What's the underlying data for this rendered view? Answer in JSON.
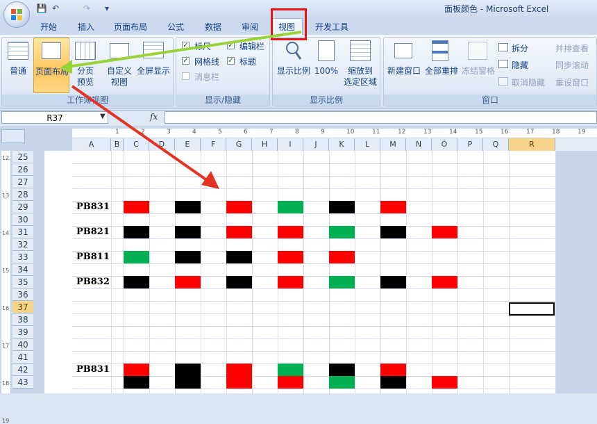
{
  "window": {
    "title": "面板颜色 - Microsoft Excel"
  },
  "tabs": [
    {
      "label": "开始"
    },
    {
      "label": "插入"
    },
    {
      "label": "页面布局"
    },
    {
      "label": "公式"
    },
    {
      "label": "数据"
    },
    {
      "label": "审阅"
    },
    {
      "label": "视图"
    },
    {
      "label": "开发工具"
    }
  ],
  "ribbon": {
    "workbook_views": {
      "group_label": "工作簿视图",
      "normal": "普通",
      "page_layout": "页面布局",
      "page_break_1": "分页",
      "page_break_2": "预览",
      "custom_1": "自定义",
      "custom_2": "视图",
      "fullscreen": "全屏显示"
    },
    "show_hide": {
      "group_label": "显示/隐藏",
      "ruler": "标尺",
      "formula_bar": "编辑栏",
      "gridlines": "网格线",
      "headings": "标题",
      "message_bar": "消息栏"
    },
    "zoom": {
      "group_label": "显示比例",
      "zoom": "显示比例",
      "hundred": "100%",
      "zoom_sel_1": "缩放到",
      "zoom_sel_2": "选定区域"
    },
    "window": {
      "group_label": "窗口",
      "new_window": "新建窗口",
      "arrange_all": "全部重排",
      "freeze": "冻结窗格",
      "split": "拆分",
      "hide": "隐藏",
      "unhide": "取消隐藏",
      "side_by_side": "并排查看",
      "sync_scroll": "同步滚动",
      "reset_pos": "重设窗口"
    }
  },
  "formula_bar": {
    "name_box": "R37",
    "fx": "fx",
    "value": ""
  },
  "columns": [
    "A",
    "B",
    "C",
    "D",
    "E",
    "F",
    "G",
    "H",
    "I",
    "J",
    "K",
    "L",
    "M",
    "N",
    "O",
    "P",
    "Q",
    "R"
  ],
  "selected_column": "R",
  "ruler_ticks": [
    "1",
    "2",
    "3",
    "4",
    "5",
    "6",
    "7",
    "8",
    "9",
    "10",
    "11",
    "12",
    "13",
    "14",
    "15",
    "16",
    "17",
    "18",
    "19"
  ],
  "rows": [
    "25",
    "26",
    "27",
    "28",
    "29",
    "30",
    "31",
    "32",
    "33",
    "34",
    "35",
    "36",
    "37",
    "38",
    "39",
    "40",
    "41",
    "42",
    "43"
  ],
  "selected_row": "37",
  "vertical_ruler": [
    "12",
    "13",
    "14",
    "15",
    "16",
    "17",
    "18",
    "19"
  ],
  "colors": {
    "red": "#ff0000",
    "black": "#000000",
    "green": "#00b050"
  },
  "sheet": {
    "labels": [
      {
        "row": "29",
        "text": "PB831"
      },
      {
        "row": "31",
        "text": "PB821"
      },
      {
        "row": "33",
        "text": "PB811"
      },
      {
        "row": "35",
        "text": "PB832"
      },
      {
        "row": "42",
        "text": "PB831"
      }
    ],
    "fills": [
      {
        "row": "29",
        "col": "C",
        "color": "red"
      },
      {
        "row": "29",
        "col": "E",
        "color": "black"
      },
      {
        "row": "29",
        "col": "G",
        "color": "red"
      },
      {
        "row": "29",
        "col": "I",
        "color": "green"
      },
      {
        "row": "29",
        "col": "K",
        "color": "black"
      },
      {
        "row": "29",
        "col": "M",
        "color": "red"
      },
      {
        "row": "31",
        "col": "C",
        "color": "black"
      },
      {
        "row": "31",
        "col": "E",
        "color": "black"
      },
      {
        "row": "31",
        "col": "G",
        "color": "red"
      },
      {
        "row": "31",
        "col": "I",
        "color": "red"
      },
      {
        "row": "31",
        "col": "K",
        "color": "green"
      },
      {
        "row": "31",
        "col": "M",
        "color": "black"
      },
      {
        "row": "31",
        "col": "O",
        "color": "red"
      },
      {
        "row": "33",
        "col": "C",
        "color": "green"
      },
      {
        "row": "33",
        "col": "E",
        "color": "black"
      },
      {
        "row": "33",
        "col": "G",
        "color": "black"
      },
      {
        "row": "33",
        "col": "I",
        "color": "red"
      },
      {
        "row": "33",
        "col": "K",
        "color": "red"
      },
      {
        "row": "35",
        "col": "C",
        "color": "black"
      },
      {
        "row": "35",
        "col": "E",
        "color": "red"
      },
      {
        "row": "35",
        "col": "G",
        "color": "black"
      },
      {
        "row": "35",
        "col": "I",
        "color": "red"
      },
      {
        "row": "35",
        "col": "K",
        "color": "green"
      },
      {
        "row": "35",
        "col": "M",
        "color": "black"
      },
      {
        "row": "35",
        "col": "O",
        "color": "red"
      },
      {
        "row": "42",
        "col": "C",
        "color": "red"
      },
      {
        "row": "42",
        "col": "E",
        "color": "black"
      },
      {
        "row": "42",
        "col": "G",
        "color": "red"
      },
      {
        "row": "42",
        "col": "I",
        "color": "green"
      },
      {
        "row": "42",
        "col": "K",
        "color": "black"
      },
      {
        "row": "42",
        "col": "M",
        "color": "red"
      },
      {
        "row": "43",
        "col": "C",
        "color": "black"
      },
      {
        "row": "43",
        "col": "E",
        "color": "black"
      },
      {
        "row": "43",
        "col": "G",
        "color": "red"
      },
      {
        "row": "43",
        "col": "I",
        "color": "red"
      },
      {
        "row": "43",
        "col": "K",
        "color": "green"
      },
      {
        "row": "43",
        "col": "M",
        "color": "black"
      },
      {
        "row": "43",
        "col": "O",
        "color": "red"
      }
    ]
  }
}
